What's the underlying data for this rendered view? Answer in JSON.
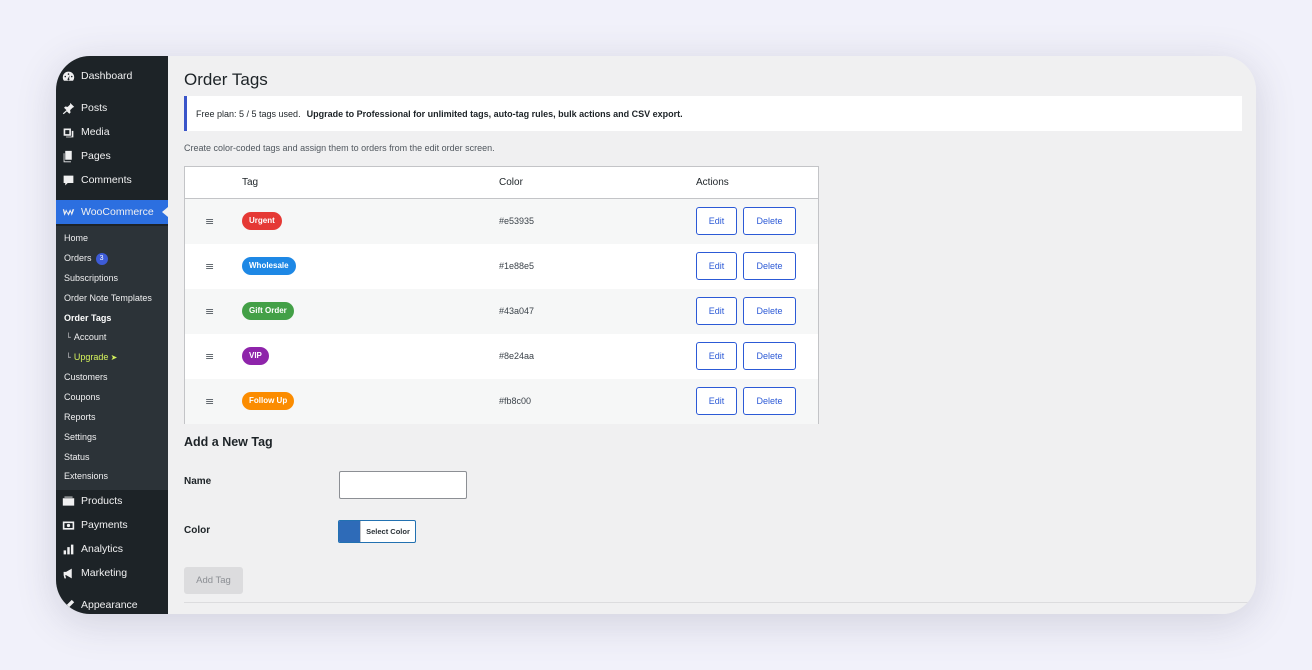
{
  "sidebar": {
    "top_items": [
      {
        "label": "Dashboard",
        "icon": "dashboard-icon"
      },
      {
        "label": "Posts",
        "icon": "pin-icon"
      },
      {
        "label": "Media",
        "icon": "media-icon"
      },
      {
        "label": "Pages",
        "icon": "pages-icon"
      },
      {
        "label": "Comments",
        "icon": "comments-icon"
      },
      {
        "label": "WooCommerce",
        "icon": "woocommerce-icon"
      }
    ],
    "sub_items": [
      {
        "label": "Home"
      },
      {
        "label": "Orders",
        "badge": "3"
      },
      {
        "label": "Subscriptions"
      },
      {
        "label": "Order Note Templates"
      },
      {
        "label": "Order Tags"
      },
      {
        "label": "Account",
        "prefix": "└"
      },
      {
        "label": "Upgrade",
        "prefix": "└",
        "suffix": "➤"
      },
      {
        "label": "Customers"
      },
      {
        "label": "Coupons"
      },
      {
        "label": "Reports"
      },
      {
        "label": "Settings"
      },
      {
        "label": "Status"
      },
      {
        "label": "Extensions"
      }
    ],
    "bottom_items": [
      {
        "label": "Products",
        "icon": "products-icon"
      },
      {
        "label": "Payments",
        "icon": "payments-icon"
      },
      {
        "label": "Analytics",
        "icon": "analytics-icon"
      },
      {
        "label": "Marketing",
        "icon": "marketing-icon"
      },
      {
        "label": "Appearance",
        "icon": "appearance-icon"
      }
    ]
  },
  "page": {
    "title": "Order Tags",
    "notice_plain": "Free plan: 5 / 5 tags used.",
    "notice_bold": "Upgrade to Professional for unlimited tags, auto-tag rules, bulk actions and CSV export.",
    "description": "Create color-coded tags and assign them to orders from the edit order screen."
  },
  "table": {
    "headers": {
      "tag": "Tag",
      "color": "Color",
      "actions": "Actions"
    },
    "drag_glyph": "≡",
    "edit_label": "Edit",
    "delete_label": "Delete",
    "rows": [
      {
        "name": "Urgent",
        "color": "#e53935"
      },
      {
        "name": "Wholesale",
        "color": "#1e88e5"
      },
      {
        "name": "Gift Order",
        "color": "#43a047"
      },
      {
        "name": "VIP",
        "color": "#8e24aa"
      },
      {
        "name": "Follow Up",
        "color": "#fb8c00"
      }
    ]
  },
  "form": {
    "section_title": "Add a New Tag",
    "name_label": "Name",
    "name_value": "",
    "color_label": "Color",
    "color_value": "#2e6bb8",
    "select_color_label": "Select Color",
    "submit_label": "Add Tag"
  }
}
